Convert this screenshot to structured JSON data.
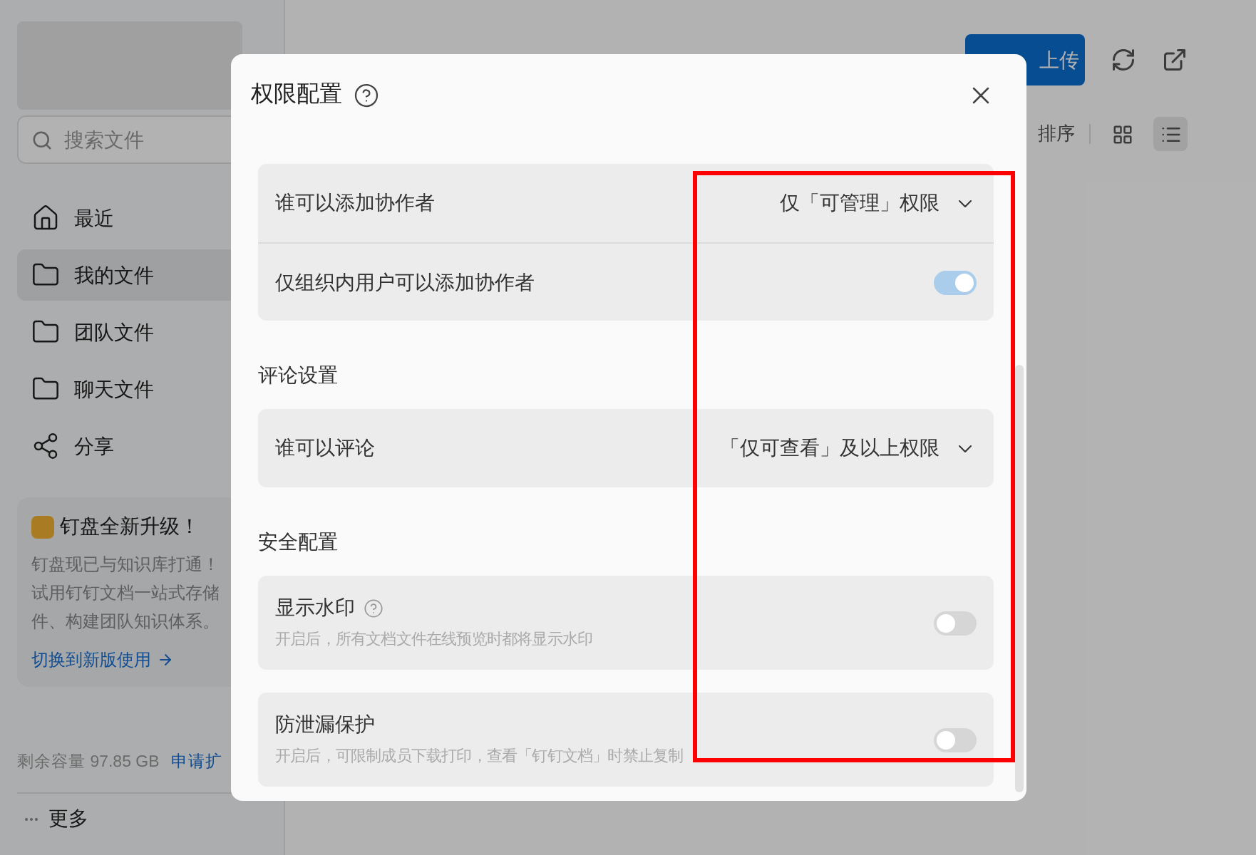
{
  "sidebar": {
    "search": {
      "placeholder": "搜索文件"
    },
    "nav": [
      {
        "label": "最近",
        "selected": false
      },
      {
        "label": "我的文件",
        "selected": true
      },
      {
        "label": "团队文件",
        "selected": false
      },
      {
        "label": "聊天文件",
        "selected": false
      },
      {
        "label": "分享",
        "selected": false
      }
    ],
    "promo": {
      "title": "钉盘全新升级！",
      "lines": [
        "钉盘现已与知识库打通！",
        "试用钉钉文档一站式存储",
        "件、构建团队知识体系。"
      ],
      "link": "切换到新版使用"
    },
    "storage": {
      "text": "剩余容量 97.85 GB",
      "link": "申请扩"
    },
    "more": "更多"
  },
  "toolbar": {
    "upload": "上传",
    "sort": "排序",
    "view": [
      {
        "selected": false
      },
      {
        "selected": true
      }
    ]
  },
  "dialog": {
    "title": "权限配置",
    "sections": [
      {
        "cards": [
          {
            "rows": [
              {
                "kind": "select",
                "label": "谁可以添加协作者",
                "value": "仅「可管理」权限"
              },
              {
                "kind": "toggle",
                "label": "仅组织内用户可以添加协作者",
                "on": true
              }
            ]
          }
        ]
      },
      {
        "title": "评论设置",
        "cards": [
          {
            "rows": [
              {
                "kind": "select",
                "label": "谁可以评论",
                "value": "「仅可查看」及以上权限"
              }
            ]
          }
        ]
      },
      {
        "title": "安全配置",
        "cards": [
          {
            "rows": [
              {
                "kind": "toggle",
                "label": "显示水印",
                "help": true,
                "description": "开启后，所有文档文件在线预览时都将显示水印",
                "on": false
              }
            ]
          },
          {
            "rows": [
              {
                "kind": "toggle",
                "label": "防泄漏保护",
                "description": "开启后，可限制成员下载打印，查看「钉钉文档」时禁止复制",
                "on": false
              }
            ]
          }
        ]
      }
    ]
  }
}
